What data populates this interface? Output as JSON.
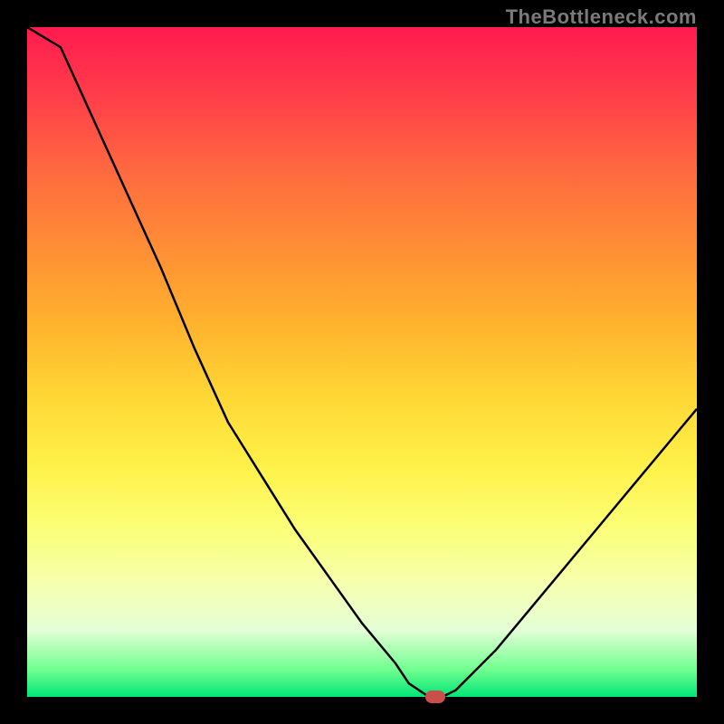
{
  "watermark": "TheBottleneck.com",
  "chart_data": {
    "type": "line",
    "title": "",
    "xlabel": "",
    "ylabel": "",
    "x": [
      0,
      5,
      10,
      15,
      20,
      25,
      30,
      35,
      40,
      45,
      50,
      55,
      57,
      60,
      62,
      64,
      70,
      75,
      80,
      85,
      90,
      95,
      100
    ],
    "values": [
      108,
      97,
      86,
      75,
      64,
      52,
      41,
      33,
      25,
      18,
      11,
      5,
      2,
      0,
      0,
      1,
      7,
      13,
      19,
      25,
      31,
      37,
      43
    ],
    "xlim": [
      0,
      100
    ],
    "ylim": [
      0,
      100
    ],
    "marker": {
      "x": 61,
      "y": 0
    },
    "background": "rainbow-vertical-gradient",
    "frame_color": "#000000"
  }
}
